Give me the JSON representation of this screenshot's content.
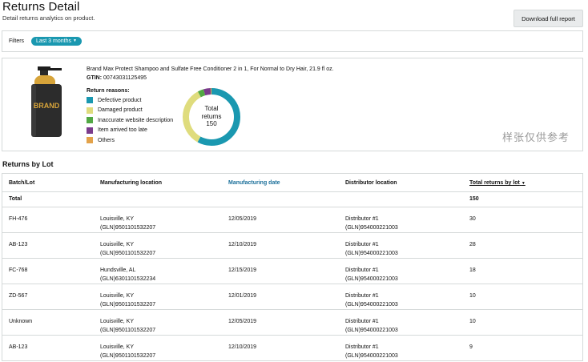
{
  "header": {
    "title": "Returns Detail",
    "subtitle": "Detail returns analytics on product.",
    "download_label": "Download full report"
  },
  "filters": {
    "label": "Filters",
    "selected": "Last 3 months"
  },
  "product": {
    "name": "Brand Max Protect Shampoo and Sulfate Free Conditioner 2 in 1, For Normal to Dry Hair, 21.9 fl oz.",
    "gtin_label": "GTIN:",
    "gtin_value": "00743031125495",
    "bottle_text": "BRAND"
  },
  "return_reasons": {
    "title": "Return reasons:",
    "items": [
      {
        "label": "Defective product",
        "color": "#1a98b0"
      },
      {
        "label": "Damaged product",
        "color": "#dfdc7d"
      },
      {
        "label": "Inaccurate website description",
        "color": "#52a844"
      },
      {
        "label": "Item arrived too late",
        "color": "#7b3b8c"
      },
      {
        "label": "Others",
        "color": "#e3a24a"
      }
    ]
  },
  "chart_data": {
    "type": "pie",
    "categories": [
      "Defective product",
      "Damaged product",
      "Inaccurate website description",
      "Item arrived too late",
      "Others"
    ],
    "values": [
      87,
      51,
      5,
      6,
      1
    ],
    "colors": [
      "#1a98b0",
      "#dfdc7d",
      "#52a844",
      "#7b3b8c",
      "#e3a24a"
    ],
    "center_label": [
      "Total",
      "returns",
      "150"
    ]
  },
  "watermark": "样张仅供参考",
  "lots": {
    "title": "Returns by Lot",
    "columns": {
      "batch": "Batch/Lot",
      "location": "Manufacturing location",
      "date": "Manufacturing date",
      "distributor": "Distributor location",
      "total": "Total returns by lot"
    },
    "sort_indicator": "▼",
    "total_row": {
      "label": "Total",
      "value": "150"
    },
    "rows": [
      {
        "batch": "FH-476",
        "loc1": "Louisville, KY",
        "loc2": "(GLN)9501101532207",
        "date": "12/05/2019",
        "dist1": "Distributor #1",
        "dist2": "(GLN)954000221003",
        "total": "30"
      },
      {
        "batch": "AB-123",
        "loc1": "Louisville, KY",
        "loc2": "(GLN)9501101532207",
        "date": "12/10/2019",
        "dist1": "Distributor #1",
        "dist2": "(GLN)954000221003",
        "total": "28"
      },
      {
        "batch": "FC-768",
        "loc1": "Hundsville, AL",
        "loc2": "(GLN)6301101532234",
        "date": "12/15/2019",
        "dist1": "Distributor #1",
        "dist2": "(GLN)954000221003",
        "total": "18"
      },
      {
        "batch": "ZD-567",
        "loc1": "Louisville, KY",
        "loc2": "(GLN)9501101532207",
        "date": "12/01/2019",
        "dist1": "Distributor #1",
        "dist2": "(GLN)954000221003",
        "total": "10"
      },
      {
        "batch": "Unknown",
        "loc1": "Louisville, KY",
        "loc2": "(GLN)9501101532207",
        "date": "12/05/2019",
        "dist1": "Distributor #1",
        "dist2": "(GLN)954000221003",
        "total": "10"
      },
      {
        "batch": "AB-123",
        "loc1": "Louisville, KY",
        "loc2": "(GLN)9501101532207",
        "date": "12/10/2019",
        "dist1": "Distributor #1",
        "dist2": "(GLN)954000221003",
        "total": "9"
      }
    ]
  }
}
